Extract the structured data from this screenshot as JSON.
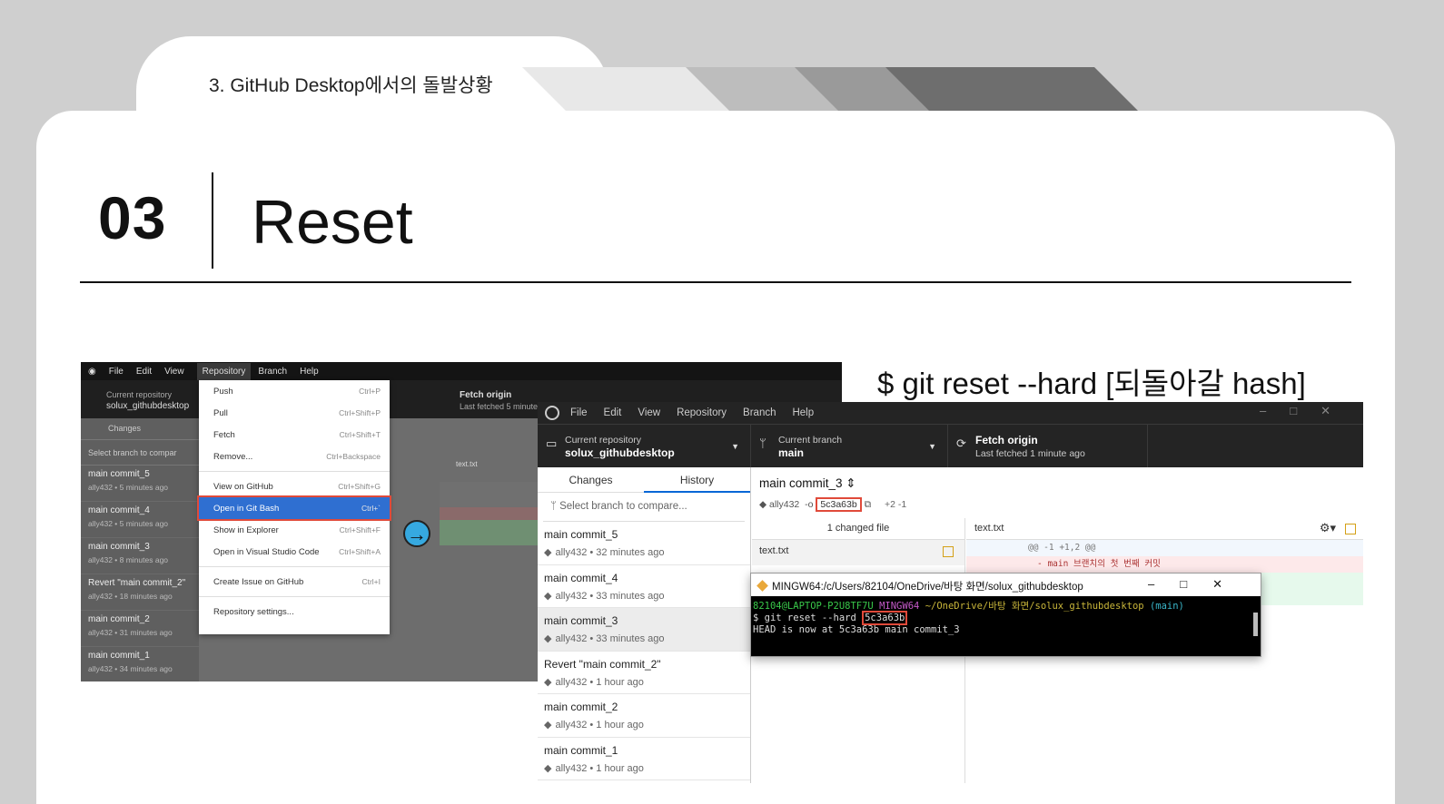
{
  "slide": {
    "header": "3. GitHub Desktop에서의 돌발상황",
    "number": "03",
    "title": "Reset",
    "command": "$ git reset --hard [되돌아갈 hash]"
  },
  "left_shot": {
    "menubar": [
      "File",
      "Edit",
      "View",
      "Repository",
      "Branch",
      "Help"
    ],
    "current_repo_label": "Current repository",
    "current_repo": "solux_githubdesktop",
    "fetch_label": "Fetch origin",
    "fetch_sub": "Last fetched 5 minute",
    "tab_changes": "Changes",
    "branch_select": "Select branch to compar",
    "commits": [
      {
        "title": "main commit_5",
        "meta": "ally432 • 5 minutes ago"
      },
      {
        "title": "main commit_4",
        "meta": "ally432 • 5 minutes ago"
      },
      {
        "title": "main commit_3",
        "meta": "ally432 • 8 minutes ago"
      },
      {
        "title": "Revert \"main commit_2\"",
        "meta": "ally432 • 18 minutes ago"
      },
      {
        "title": "main commit_2",
        "meta": "ally432 • 31 minutes ago"
      },
      {
        "title": "main commit_1",
        "meta": "ally432 • 34 minutes ago"
      }
    ],
    "diff_file": "text.txt",
    "menu": [
      {
        "label": "Push",
        "shortcut": "Ctrl+P"
      },
      {
        "label": "Pull",
        "shortcut": "Ctrl+Shift+P"
      },
      {
        "label": "Fetch",
        "shortcut": "Ctrl+Shift+T"
      },
      {
        "label": "Remove...",
        "shortcut": "Ctrl+Backspace"
      },
      {
        "label": "View on GitHub",
        "shortcut": "Ctrl+Shift+G"
      },
      {
        "label": "Open in Git Bash",
        "shortcut": "Ctrl+`"
      },
      {
        "label": "Show in Explorer",
        "shortcut": "Ctrl+Shift+F"
      },
      {
        "label": "Open in Visual Studio Code",
        "shortcut": "Ctrl+Shift+A"
      },
      {
        "label": "Create Issue on GitHub",
        "shortcut": "Ctrl+I"
      },
      {
        "label": "Repository settings...",
        "shortcut": ""
      }
    ]
  },
  "right_shot": {
    "menubar": [
      "File",
      "Edit",
      "View",
      "Repository",
      "Branch",
      "Help"
    ],
    "current_repo_label": "Current repository",
    "current_repo": "solux_githubdesktop",
    "current_branch_label": "Current branch",
    "current_branch": "main",
    "fetch_label": "Fetch origin",
    "fetch_sub": "Last fetched 1 minute ago",
    "tab_changes": "Changes",
    "tab_history": "History",
    "branch_select": "Select branch to compare...",
    "commits": [
      {
        "title": "main commit_5",
        "meta": "ally432 • 32 minutes ago"
      },
      {
        "title": "main commit_4",
        "meta": "ally432 • 33 minutes ago"
      },
      {
        "title": "main commit_3",
        "meta": "ally432 • 33 minutes ago"
      },
      {
        "title": "Revert \"main commit_2\"",
        "meta": "ally432 • 1 hour ago"
      },
      {
        "title": "main commit_2",
        "meta": "ally432 • 1 hour ago"
      },
      {
        "title": "main commit_1",
        "meta": "ally432 • 1 hour ago"
      }
    ],
    "selected_commit_title": "main commit_3",
    "author": "ally432",
    "hash": "5c3a63b",
    "diffstat": "+2 -1",
    "changed_files": "1 changed file",
    "file": "text.txt",
    "hunk": "@@ -1 +1,2 @@",
    "del_line": "- main 브랜치의 첫 번째 커밋"
  },
  "terminal": {
    "title": "MINGW64:/c/Users/82104/OneDrive/바탕 화면/solux_githubdesktop",
    "prompt_user": "82104@LAPTOP-P2U8TF7U",
    "prompt_env": "MINGW64",
    "prompt_path": "~/OneDrive/바탕 화면/solux_githubdesktop",
    "prompt_branch": "(main)",
    "command": "$ git reset --hard ",
    "hash": "5c3a63b",
    "output": "HEAD is now at 5c3a63b main commit_3"
  },
  "colors": {
    "highlight_box": "#e04a3a",
    "menu_selection": "#2f6fd1",
    "arrow_badge": "#36a9e0"
  }
}
